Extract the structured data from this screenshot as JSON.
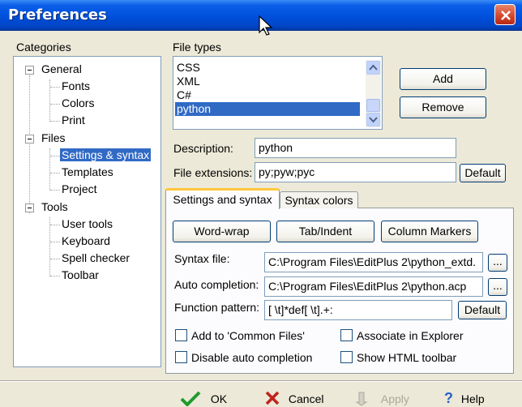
{
  "window": {
    "title": "Preferences"
  },
  "categories": {
    "label": "Categories",
    "items": [
      {
        "label": "General"
      },
      {
        "label": "Fonts"
      },
      {
        "label": "Colors"
      },
      {
        "label": "Print"
      },
      {
        "label": "Files"
      },
      {
        "label": "Settings & syntax"
      },
      {
        "label": "Templates"
      },
      {
        "label": "Project"
      },
      {
        "label": "Tools"
      },
      {
        "label": "User tools"
      },
      {
        "label": "Keyboard"
      },
      {
        "label": "Spell checker"
      },
      {
        "label": "Toolbar"
      }
    ],
    "selected": "Settings & syntax"
  },
  "file_types": {
    "label": "File types",
    "items": [
      "CSS",
      "XML",
      "C#",
      "python"
    ],
    "selected": "python",
    "add_label": "Add",
    "remove_label": "Remove"
  },
  "description": {
    "label": "Description:",
    "value": "python"
  },
  "file_extensions": {
    "label": "File extensions:",
    "value": "py;pyw;pyc",
    "default_label": "Default"
  },
  "tabs": [
    {
      "label": "Settings and syntax",
      "active": true
    },
    {
      "label": "Syntax colors",
      "active": false
    }
  ],
  "settings": {
    "word_wrap_label": "Word-wrap",
    "tab_indent_label": "Tab/Indent",
    "column_markers_label": "Column Markers",
    "syntax_file": {
      "label": "Syntax file:",
      "value": "C:\\Program Files\\EditPlus 2\\python_extd.",
      "browse_label": "..."
    },
    "auto_completion": {
      "label": "Auto completion:",
      "value": "C:\\Program Files\\EditPlus 2\\python.acp",
      "browse_label": "..."
    },
    "function_pattern": {
      "label": "Function pattern:",
      "value": "[ \\t]*def[ \\t].+:",
      "default_label": "Default"
    },
    "checkboxes": {
      "add_common": {
        "label": "Add to 'Common Files'",
        "checked": false
      },
      "associate_explorer": {
        "label": "Associate in Explorer",
        "checked": false
      },
      "disable_auto_completion": {
        "label": "Disable auto completion",
        "checked": false
      },
      "show_html_toolbar": {
        "label": "Show HTML toolbar",
        "checked": false
      }
    }
  },
  "footer": {
    "ok_label": "OK",
    "cancel_label": "Cancel",
    "apply_label": "Apply",
    "help_label": "Help"
  },
  "colors": {
    "selection": "#316ac5",
    "titlebar": "#0050dc",
    "dialog_bg": "#ece9d8",
    "active_tab_accent": "#ffc73c"
  }
}
